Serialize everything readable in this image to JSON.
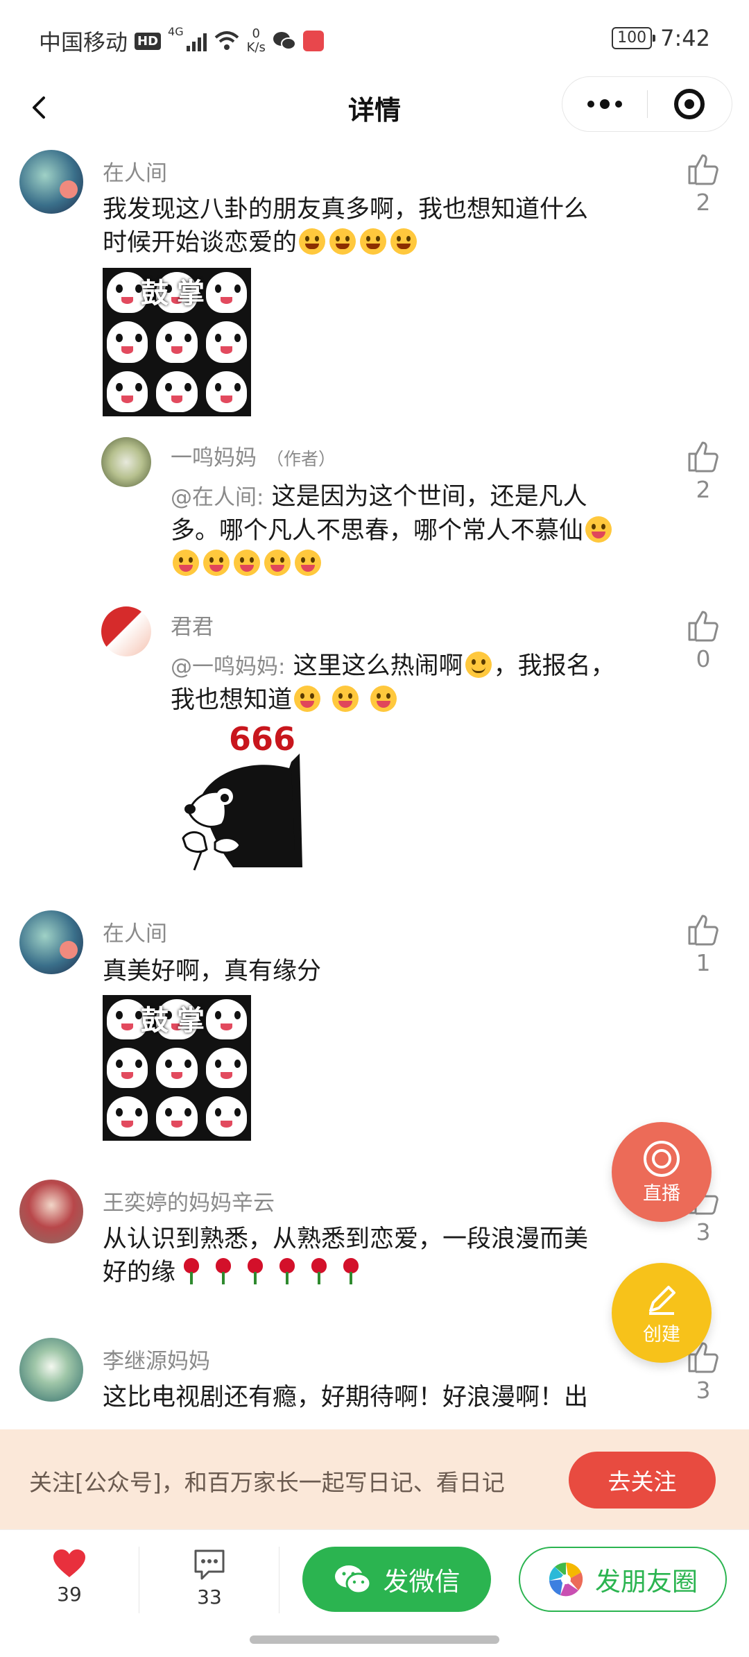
{
  "status_bar": {
    "carrier": "中国移动",
    "hd": "HD",
    "network": "4G",
    "speed_value": "0",
    "speed_unit": "K/s",
    "battery": "100",
    "time": "7:42"
  },
  "nav": {
    "title": "详情"
  },
  "comments": [
    {
      "name": "在人间",
      "text_line1": "我发现这八卦的朋友真多啊，我也想知道什么",
      "text_line2": "时候开始谈恋爱的",
      "likes": "2",
      "sticker_caption": "鼓掌"
    },
    {
      "name": "一鸣妈妈",
      "author_tag": "（作者）",
      "mention": "@在人间:",
      "text_line1": "这是因为这个世间，还是凡人",
      "text_line2": "多。哪个凡人不思春，哪个常人不慕仙",
      "likes": "2"
    },
    {
      "name": "君君",
      "mention": "@一鸣妈妈:",
      "text_line1": "这里这么热闹啊",
      "text_line1b": "，我报名，",
      "text_line2": "我也想知道",
      "likes": "0",
      "sticker_caption": "666"
    },
    {
      "name": "在人间",
      "text_line1": "真美好啊，真有缘分",
      "likes": "1",
      "sticker_caption": "鼓掌"
    },
    {
      "name": "王奕婷的妈妈辛云",
      "text_line1": "从认识到熟悉，从熟悉到恋爱，一段浪漫而美",
      "text_line2": "好的缘",
      "likes": "3"
    },
    {
      "name": "李继源妈妈",
      "text_line1": "这比电视剧还有瘾，好期待啊！好浪漫啊！出",
      "likes": "3"
    }
  ],
  "fab": {
    "live": "直播",
    "create": "创建"
  },
  "follow_banner": {
    "text": "关注[公众号]，和百万家长一起写日记、看日记",
    "button": "去关注"
  },
  "bottom_bar": {
    "likes": "39",
    "comments": "33",
    "wechat": "发微信",
    "moments": "发朋友圈"
  },
  "colors": {
    "live_fab": "#ec6b58",
    "create_fab": "#f7c21a",
    "follow_button": "#e84b40",
    "wechat_green": "#2bb450",
    "heart_red": "#e8303d"
  }
}
